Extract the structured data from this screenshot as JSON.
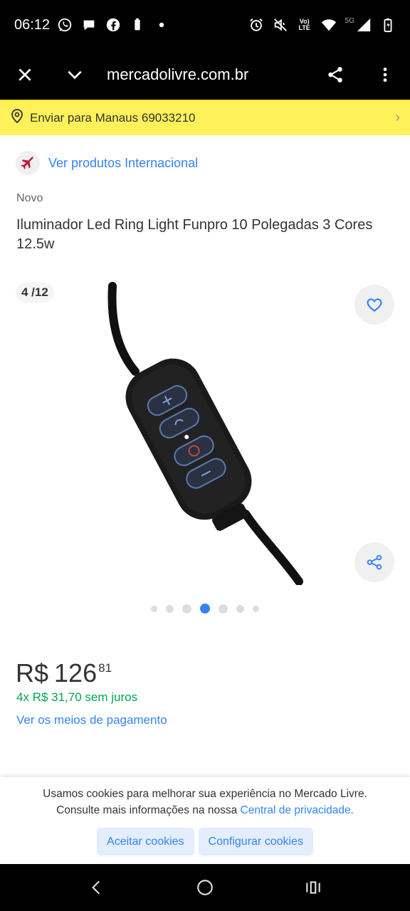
{
  "status_bar": {
    "time": "06:12",
    "left_icons": [
      "whatsapp-icon",
      "chat-bubble-icon",
      "facebook-icon",
      "battery-saver-icon",
      "dot-icon"
    ],
    "right_icons": [
      "alarm-icon",
      "mute-icon",
      "volte-icon",
      "wifi-icon",
      "signal-icon",
      "battery-icon"
    ],
    "volte_label": "Vo) LTE",
    "network_label": "5G"
  },
  "browser": {
    "url": "mercadolivre.com.br",
    "close_icon": "close-icon",
    "menu_icon": "chevron-down-icon",
    "share_icon": "share-icon",
    "more_icon": "more-vertical-icon"
  },
  "shipping_banner": {
    "text": "Enviar para Manaus 69033210",
    "chevron": "›"
  },
  "international": {
    "link": "Ver produtos Internacional"
  },
  "product": {
    "condition": "Novo",
    "title": "Iluminador Led Ring Light Funpro 10 Polegadas 3 Cores 12.5w",
    "image_counter": "4 /12",
    "current_image": 4,
    "total_images": 12
  },
  "price": {
    "currency": "R$",
    "integer": "126",
    "cents": "81",
    "installments": "4x R$ 31,70 sem juros",
    "payment_link": "Ver os meios de pagamento"
  },
  "cookie_banner": {
    "line1": "Usamos cookies para melhorar sua experiência no Mercado Livre.",
    "line2_prefix": "Consulte mais informações na nossa",
    "line2_link": "Central de privacidade.",
    "accept": "Aceitar cookies",
    "configure": "Configurar cookies"
  },
  "colors": {
    "brand_yellow": "#fff159",
    "link_blue": "#3483fa",
    "success_green": "#00a650",
    "button_bg": "#e3edfb"
  },
  "nav_bar": {
    "icons": [
      "back-icon",
      "home-icon",
      "recents-icon"
    ]
  }
}
